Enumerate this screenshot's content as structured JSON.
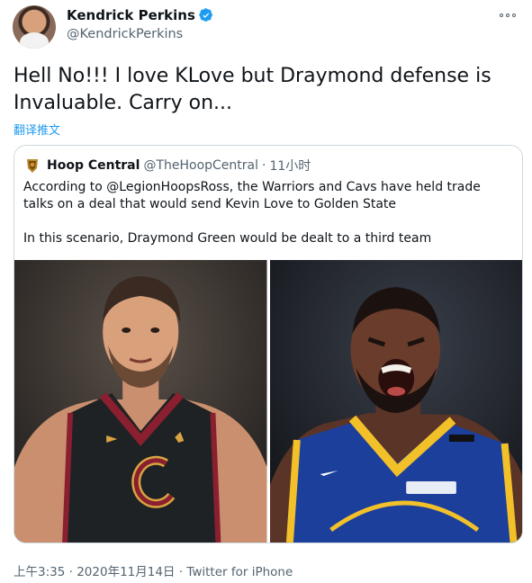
{
  "author": {
    "name": "Kendrick Perkins",
    "handle": "@KendrickPerkins",
    "verified": true,
    "avatar_icon": "avatar-profile"
  },
  "tweet": {
    "text": "Hell No!!! I love KLove but Draymond defense is Invaluable. Carry on...",
    "translate_label": "翻译推文"
  },
  "quoted": {
    "name": "Hoop Central",
    "handle": "@TheHoopCentral",
    "separator": "·",
    "time": "11小时",
    "paragraphs": [
      "According to @LegionHoopsRoss, the Warriors and Cavs have held trade talks on a deal that would send Kevin Love to Golden State",
      "In this scenario, Draymond Green would be dealt to a third team"
    ],
    "photos": [
      {
        "icon": "photo-cavaliers-player",
        "jersey_colors": [
          "#1f2224",
          "#8a1f2f",
          "#d9a441"
        ]
      },
      {
        "icon": "photo-warriors-player",
        "jersey_colors": [
          "#1d3f9c",
          "#f2c029"
        ]
      }
    ]
  },
  "footer": {
    "time": "上午3:35",
    "separator": "·",
    "date": "2020年11月14日",
    "separator2": "·",
    "source": "Twitter for iPhone"
  },
  "colors": {
    "link": "#1d9bf0",
    "secondary_text": "#536471",
    "border": "#cfd9de"
  }
}
